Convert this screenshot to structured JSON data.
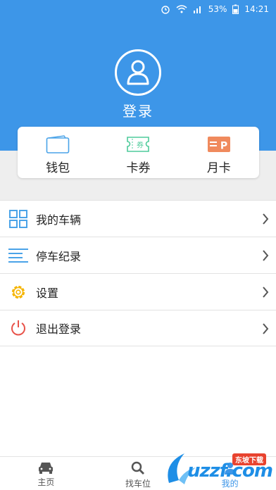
{
  "status_bar": {
    "battery": "53%",
    "time": "14:21"
  },
  "profile": {
    "login_label": "登录"
  },
  "wallet_card": {
    "items": [
      {
        "label": "钱包",
        "icon": "wallet-icon"
      },
      {
        "label": "卡券",
        "icon": "coupon-icon",
        "icon_text": "券"
      },
      {
        "label": "月卡",
        "icon": "monthly-card-icon",
        "icon_text": "P"
      }
    ]
  },
  "menu": {
    "items": [
      {
        "label": "我的车辆",
        "icon": "grid-icon"
      },
      {
        "label": "停车纪录",
        "icon": "list-icon"
      },
      {
        "label": "设置",
        "icon": "gear-icon"
      },
      {
        "label": "退出登录",
        "icon": "power-icon"
      }
    ]
  },
  "bottom_nav": {
    "items": [
      {
        "label": "主页",
        "icon": "car-icon"
      },
      {
        "label": "找车位",
        "icon": "search-icon"
      },
      {
        "label": "我的",
        "icon": "person-icon",
        "active": true
      }
    ]
  },
  "watermark": {
    "text": "uzzf.com",
    "badge": "东坡下载"
  },
  "colors": {
    "brand_blue": "#3d96e8",
    "coupon_green": "#4ecb9b",
    "monthly_orange": "#f08a5d",
    "gear_yellow": "#f5b400",
    "power_red": "#e8534a"
  }
}
